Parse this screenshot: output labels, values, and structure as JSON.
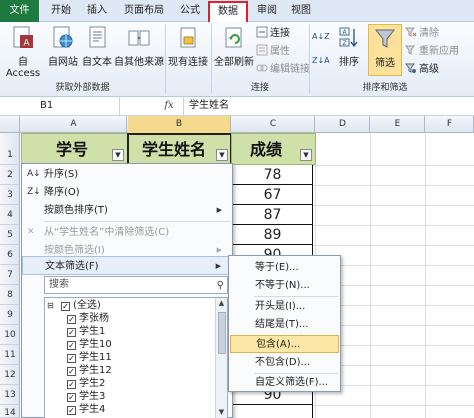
{
  "menu": {
    "tabs": [
      "文件",
      "开始",
      "插入",
      "页面布局",
      "公式",
      "数据",
      "审阅",
      "视图"
    ]
  },
  "ribbon": {
    "get_external": {
      "label": "获取外部数据",
      "buttons": [
        "自 Access",
        "自网站",
        "自文本",
        "自其他来源"
      ]
    },
    "existing_connection": "现有连接",
    "connections": {
      "label": "连接",
      "refresh_all": "全部刷新",
      "connect": "连接",
      "properties": "属性",
      "edit_links": "编辑链接"
    },
    "sort_filter": {
      "label": "排序和筛选",
      "sort_az": "A↓Z",
      "sort_za": "Z↓A",
      "sort": "排序",
      "filter": "筛选",
      "clear": "清除",
      "reapply": "重新应用",
      "advanced": "高级"
    }
  },
  "formula_bar": {
    "name_box": "B1",
    "fx": "fx",
    "formula": "学生姓名"
  },
  "sheet": {
    "columns": [
      "A",
      "B",
      "C",
      "D",
      "E",
      "F"
    ],
    "rows": [
      "1",
      "2",
      "3",
      "4",
      "5",
      "6",
      "7",
      "8",
      "9",
      "10",
      "11",
      "12",
      "13",
      "14"
    ],
    "headers": [
      "学号",
      "学生姓名",
      "成绩"
    ],
    "scores": [
      "78",
      "67",
      "87",
      "89",
      "90",
      "90"
    ]
  },
  "filter_menu": {
    "sort_asc": "升序(S)",
    "sort_desc": "降序(O)",
    "sort_by_color": "按颜色排序(T)",
    "clear_filter": "从“学生姓名”中清除筛选(C)",
    "filter_by_color": "按颜色筛选(I)",
    "text_filters": "文本筛选(F)",
    "search_placeholder": "搜索",
    "items": [
      "(全选)",
      "李张杨",
      "学生1",
      "学生10",
      "学生11",
      "学生12",
      "学生2",
      "学生3",
      "学生4"
    ]
  },
  "text_filter_submenu": {
    "items": [
      "等于(E)...",
      "不等于(N)...",
      "开头是(I)...",
      "结尾是(T)...",
      "包含(A)...",
      "不包含(D)...",
      "自定义筛选(F)..."
    ]
  },
  "colors": {
    "file_tab": "#1e7a3e",
    "header_fill": "#cfe0a8",
    "highlight_border": "#e0202a",
    "filter_active": "#fbe19a",
    "submenu_hot": "#fde7a6"
  }
}
